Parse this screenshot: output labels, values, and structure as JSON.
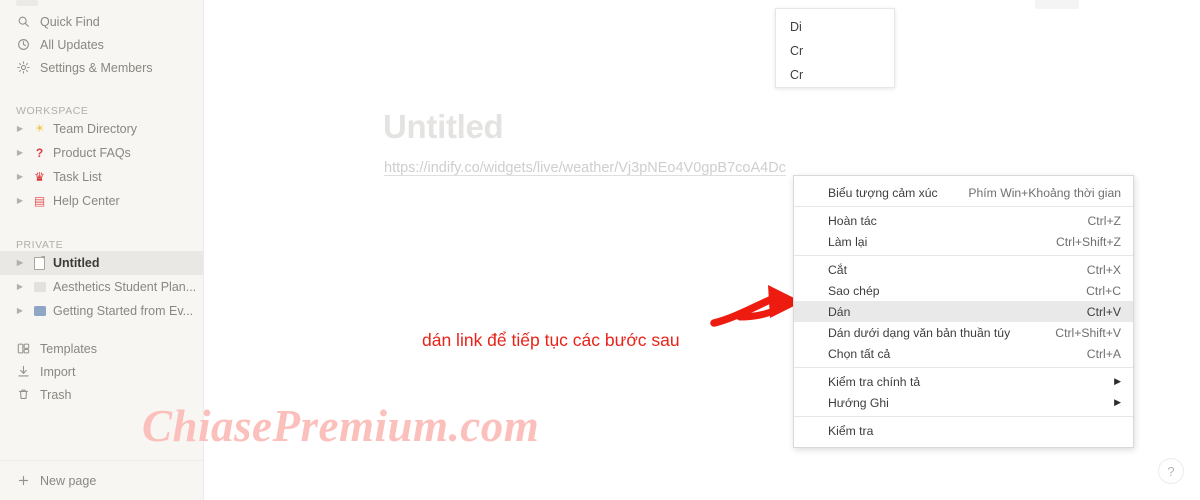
{
  "sidebar": {
    "top_items": [
      {
        "label": "Quick Find",
        "icon": "search-icon"
      },
      {
        "label": "All Updates",
        "icon": "clock-icon"
      },
      {
        "label": "Settings & Members",
        "icon": "gear-icon"
      }
    ],
    "workspace_section_label": "WORKSPACE",
    "workspace_pages": [
      {
        "label": "Team Directory",
        "emoji": "☀",
        "emoji_color": "#f2c33c"
      },
      {
        "label": "Product FAQs",
        "emoji": "?",
        "emoji_color": "#e03e3e"
      },
      {
        "label": "Task List",
        "emoji": "♛",
        "emoji_color": "#d92c2c"
      },
      {
        "label": "Help Center",
        "emoji": "▤",
        "emoji_color": "#e35757"
      }
    ],
    "private_section_label": "PRIVATE",
    "private_pages": [
      {
        "label": "Untitled",
        "emoji": "doc",
        "emoji_color": "#a9a6a0",
        "selected": true
      },
      {
        "label": "Aesthetics Student Plan...",
        "emoji": "sq",
        "emoji_color": "#e3e1de",
        "selected": false
      },
      {
        "label": "Getting Started from Ev...",
        "emoji": "sq",
        "emoji_color": "#8fa6c4",
        "selected": false
      }
    ],
    "utility_items": [
      {
        "label": "Templates",
        "icon": "templates-icon"
      },
      {
        "label": "Import",
        "icon": "import-icon"
      },
      {
        "label": "Trash",
        "icon": "trash-icon"
      }
    ],
    "new_page_label": "New page",
    "new_page_icon": "plus-icon"
  },
  "main": {
    "page_title": "Untitled",
    "page_url": "https://indify.co/widgets/live/weather/Vj3pNEo4V0gpB7coA4Dc",
    "annotation_text": "dán link để tiếp tục các bước sau",
    "watermark": "ChiasePremium.com",
    "help_label": "?",
    "annotation_color": "#e8231a",
    "watermark_color": "#fbc0bb"
  },
  "background_menu": {
    "items": [
      {
        "label": "Di"
      },
      {
        "label": "Cr"
      },
      {
        "label": "Cr"
      }
    ]
  },
  "context_menu": {
    "groups": [
      {
        "items": [
          {
            "label": "Biểu tượng cảm xúc",
            "accel": "Phím Win+Khoảng thời gian",
            "highlight": false,
            "submenu": false
          }
        ]
      },
      {
        "items": [
          {
            "label": "Hoàn tác",
            "accel": "Ctrl+Z",
            "highlight": false,
            "submenu": false
          },
          {
            "label": "Làm lại",
            "accel": "Ctrl+Shift+Z",
            "highlight": false,
            "submenu": false
          }
        ]
      },
      {
        "items": [
          {
            "label": "Cắt",
            "accel": "Ctrl+X",
            "highlight": false,
            "submenu": false
          },
          {
            "label": "Sao chép",
            "accel": "Ctrl+C",
            "highlight": false,
            "submenu": false
          },
          {
            "label": "Dán",
            "accel": "Ctrl+V",
            "highlight": true,
            "submenu": false
          },
          {
            "label": "Dán dưới dạng văn bản thuần túy",
            "accel": "Ctrl+Shift+V",
            "highlight": false,
            "submenu": false
          },
          {
            "label": "Chọn tất cả",
            "accel": "Ctrl+A",
            "highlight": false,
            "submenu": false
          }
        ]
      },
      {
        "items": [
          {
            "label": "Kiểm tra chính tả",
            "accel": "",
            "highlight": false,
            "submenu": true
          },
          {
            "label": "Hướng Ghi",
            "accel": "",
            "highlight": false,
            "submenu": true
          }
        ]
      },
      {
        "items": [
          {
            "label": "Kiểm tra",
            "accel": "",
            "highlight": false,
            "submenu": false
          }
        ]
      }
    ]
  }
}
